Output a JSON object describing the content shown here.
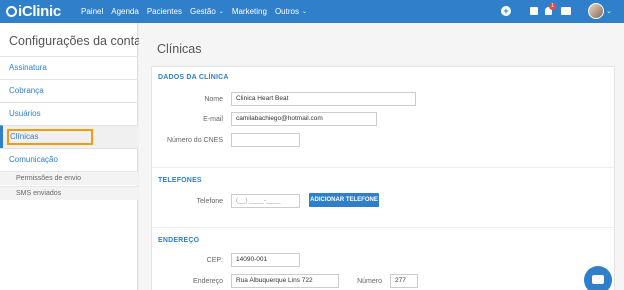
{
  "brand": {
    "name": "iClinic"
  },
  "nav": {
    "items": [
      {
        "label": "Painel"
      },
      {
        "label": "Agenda"
      },
      {
        "label": "Pacientes"
      },
      {
        "label": "Gestão",
        "caret": "⌄"
      },
      {
        "label": "Marketing"
      },
      {
        "label": "Outros",
        "caret": "⌄"
      }
    ],
    "notification_count": "1",
    "icons": [
      "plus-icon",
      "gift-icon",
      "bell-icon",
      "chat-icon",
      "avatar"
    ]
  },
  "sidebar": {
    "title": "Configurações da conta",
    "items": [
      {
        "label": "Assinatura"
      },
      {
        "label": "Cobrança"
      },
      {
        "label": "Usuários"
      },
      {
        "label": "Clínicas"
      },
      {
        "label": "Comunicação"
      }
    ],
    "subitems": [
      {
        "label": "Permissões de envio"
      },
      {
        "label": "SMS enviados"
      }
    ],
    "active": "Clínicas"
  },
  "main": {
    "title": "Clínicas",
    "dados": {
      "section_title": "DADOS DA CLÍNICA",
      "nome_label": "Nome",
      "nome_value": "Clinica Heart Beat",
      "email_label": "E-mail",
      "email_value": "camilabachiego@hotmail.com",
      "cnes_label": "Número do CNES",
      "cnes_value": ""
    },
    "telefones": {
      "section_title": "TELEFONES",
      "telefone_label": "Telefone",
      "telefone_placeholder": "(__) ____-____",
      "add_button": "ADICIONAR TELEFONE"
    },
    "endereco": {
      "section_title": "ENDEREÇO",
      "cep_label": "CEP:",
      "cep_value": "14090-001",
      "endereco_label": "Endereço",
      "endereco_value": "Rua Albuquerque Lins 722",
      "numero_label": "Número",
      "numero_value": "277"
    }
  },
  "colors": {
    "primary": "#2f7fcb",
    "highlight": "#f39c12",
    "badge": "#e74c3c"
  }
}
